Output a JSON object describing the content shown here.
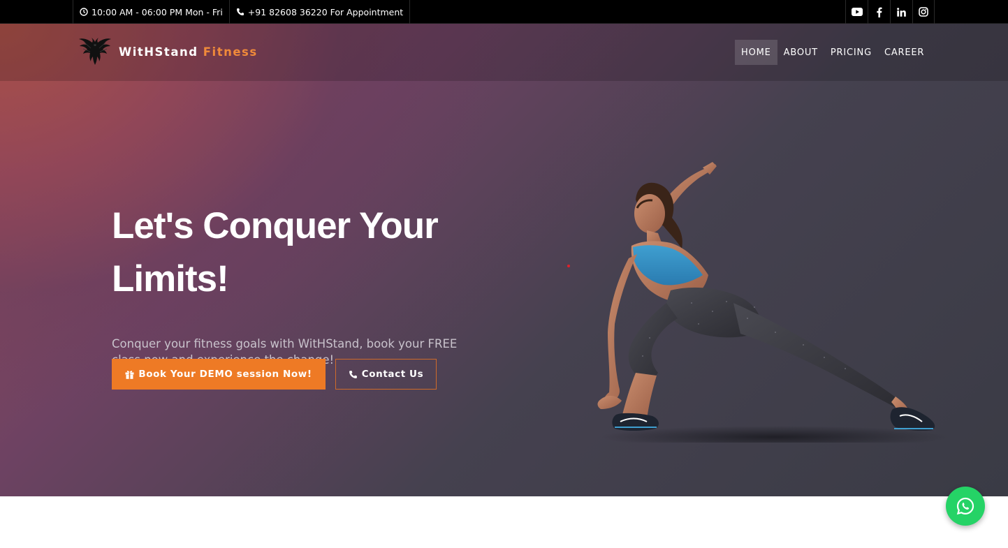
{
  "topbar": {
    "hours": "10:00 AM - 06:00 PM Mon - Fri",
    "phone": "+91 82608 36220 For Appointment",
    "hours_icon": "clock-icon",
    "phone_icon": "phone-icon",
    "social": [
      {
        "name": "youtube",
        "icon": "youtube-icon"
      },
      {
        "name": "facebook",
        "icon": "facebook-icon"
      },
      {
        "name": "linkedin",
        "icon": "linkedin-icon"
      },
      {
        "name": "instagram",
        "icon": "instagram-icon"
      }
    ]
  },
  "brand": {
    "name_main": "WitHStand",
    "name_accent": "Fitness",
    "logo_icon": "phoenix-logo"
  },
  "nav": {
    "items": [
      "HOME",
      "ABOUT",
      "PRICING",
      "CAREER"
    ],
    "active": "HOME"
  },
  "hero": {
    "headline": "Let's Conquer Your Limits!",
    "subtext": "Conquer your fitness goals with WitHStand, book your FREE class now and experience the change!",
    "primary_button": "Book Your DEMO session Now!",
    "primary_icon": "gift-icon",
    "secondary_button": "Contact Us",
    "secondary_icon": "phone-icon",
    "image": "athlete-lunge-illustration"
  },
  "floating": {
    "whatsapp_icon": "whatsapp-icon"
  },
  "colors": {
    "accent": "#ee7a25",
    "topbar_bg": "#000000",
    "whatsapp": "#25d366",
    "hero_dark": "#3a3b45",
    "hero_warm": "#9a4c5b"
  }
}
